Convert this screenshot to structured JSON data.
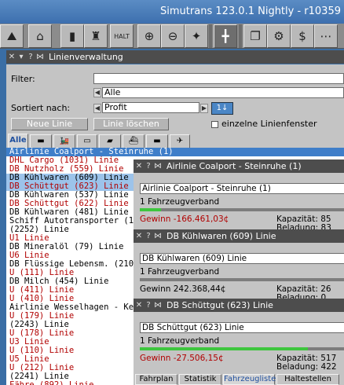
{
  "app_title": "Simutrans 123.0.1 Nightly - r10359",
  "toolbar": {
    "icons": [
      "hill-icon",
      "house-icon",
      "chart-icon",
      "market-icon",
      "halt-list-icon",
      "zoom-in-icon",
      "zoom-out-icon",
      "rotate-compass-icon",
      "network-icon",
      "copy-icon",
      "settings-icon",
      "finance-icon"
    ],
    "halt_label": "HALT"
  },
  "line_manager": {
    "title": "Linienverwaltung",
    "filter_label": "Filter:",
    "filter_value": "",
    "category_value": "Alle",
    "sort_label": "Sortiert nach:",
    "sort_value": "Profit",
    "sort_dir": "1↓",
    "new_line_button": "Neue Linie",
    "delete_line_button": "Linie löschen",
    "separate_windows_label": "einzelne Linienfenster",
    "tabs": [
      "Alle",
      "bus",
      "train",
      "tram",
      "ship",
      "air",
      "car"
    ],
    "lines": [
      {
        "text": "Airlinie Coalport - Steinruhe (1)",
        "state": "sel-head",
        "color": "black"
      },
      {
        "text": "DHL Cargo (1031) Linie",
        "state": "",
        "color": "red"
      },
      {
        "text": "DB Nutzholz (559) Linie",
        "state": "",
        "color": "red"
      },
      {
        "text": "DB Kühlwaren (609) Linie",
        "state": "sel",
        "color": "black"
      },
      {
        "text": "DB Schüttgut (623) Linie",
        "state": "sel",
        "color": "red"
      },
      {
        "text": "DB Kühlwaren (537) Linie",
        "state": "",
        "color": "black"
      },
      {
        "text": "DB Schüttgut (622) Linie",
        "state": "",
        "color": "red"
      },
      {
        "text": "DB Kühlwaren (481) Linie",
        "state": "",
        "color": "black"
      },
      {
        "text": "Schiff Autotransporter (197)",
        "state": "",
        "color": "black"
      },
      {
        "text": "(2252) Linie",
        "state": "",
        "color": "black"
      },
      {
        "text": "U1 Linie",
        "state": "",
        "color": "red"
      },
      {
        "text": "DB Mineralöl (79) Linie",
        "state": "",
        "color": "black"
      },
      {
        "text": "U6 Linie",
        "state": "",
        "color": "red"
      },
      {
        "text": "DB Flüssige Lebensm. (2100)",
        "state": "",
        "color": "black"
      },
      {
        "text": "U (111) Linie",
        "state": "",
        "color": "red"
      },
      {
        "text": "DB Milch (454) Linie",
        "state": "",
        "color": "black"
      },
      {
        "text": "U (411) Linie",
        "state": "",
        "color": "red"
      },
      {
        "text": "U (410) Linie",
        "state": "",
        "color": "red"
      },
      {
        "text": "Airlinie Wesselhagen - Kehr",
        "state": "",
        "color": "black"
      },
      {
        "text": "U (179) Linie",
        "state": "",
        "color": "red"
      },
      {
        "text": "(2243) Linie",
        "state": "",
        "color": "black"
      },
      {
        "text": "U (178) Linie",
        "state": "",
        "color": "red"
      },
      {
        "text": "U3 Linie",
        "state": "",
        "color": "red"
      },
      {
        "text": "U (110) Linie",
        "state": "",
        "color": "red"
      },
      {
        "text": "U5 Linie",
        "state": "",
        "color": "red"
      },
      {
        "text": "U (212) Linie",
        "state": "",
        "color": "red"
      },
      {
        "text": "(2241) Linie",
        "state": "",
        "color": "black"
      },
      {
        "text": "Fähre (892) Linie",
        "state": "",
        "color": "red"
      }
    ]
  },
  "detail_windows": [
    {
      "title": "Airlinie Coalport - Steinruhe (1)",
      "name_value": "Airlinie Coalport - Steinruhe (1)",
      "convoys": "1 Fahrzeugverband",
      "profit": "Gewinn -166.461,03¢",
      "profit_color": "#b10000",
      "load": 0.1,
      "capacity": "Kapazität: 85",
      "loading": "Beladung: 83"
    },
    {
      "title": "DB Kühlwaren (609) Linie",
      "name_value": "DB Kühlwaren (609) Linie",
      "convoys": "1 Fahrzeugverband",
      "profit": "Gewinn 242.368,44¢",
      "profit_color": "#000000",
      "load": 0.0,
      "capacity": "Kapazität: 26",
      "loading": "Beladung: 0"
    },
    {
      "title": "DB Schüttgut (623) Linie",
      "name_value": "DB Schüttgut (623) Linie",
      "convoys": "1 Fahrzeugverband",
      "profit": "Gewinn -27.506,15¢",
      "profit_color": "#b10000",
      "load": 0.8,
      "capacity": "Kapazität: 517",
      "loading": "Beladung: 422",
      "tabs": [
        "Fahrplan",
        "Statistik",
        "Fahrzeugliste",
        "Haltestellen"
      ]
    }
  ]
}
